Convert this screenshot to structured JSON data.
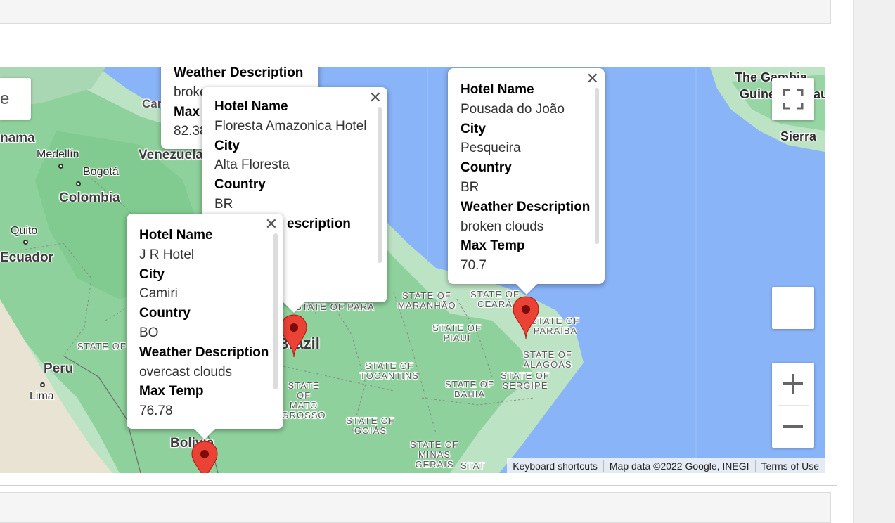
{
  "map": {
    "labels": {
      "the_gambia": "The Gambia",
      "guinea": "Guinea-Bissau",
      "sierra": "Sierra",
      "panama": "nama",
      "medellin": "Medellín",
      "bogota": "Bogotá",
      "colombia": "Colombia",
      "venezuela": "Venezuela",
      "caribbean": "Car",
      "quito": "Quito",
      "ecuador": "Ecuador",
      "peru": "Peru",
      "lima": "Lima",
      "brazil": "Brazil",
      "bolivia": "Bolivia",
      "state_para": "STATE OF PARÁ",
      "state_maranhao": "STATE OF MARANHÃO",
      "state_ceara": "STATE OF CEARÁ",
      "state_paraiba": "STATE OF PARAÍBA",
      "state_piaui": "STATE OF PIAUÍ",
      "state_alagoas": "STATE OF ALAGOAS",
      "state_sergipe": "STATE OF SERGIPE",
      "state_bahia": "STATE OF BAHIA",
      "state_tocantins": "STATE OF TOCANTINS",
      "state_mato_grosso": "STATE OF MATO GROSSO",
      "state_goias": "STATE OF GOIÁS",
      "state_minas": "STATE OF MINAS GERAIS",
      "state_west": "STATE OF",
      "state_es": "STAT"
    },
    "search_stub_text": "e",
    "footer": {
      "shortcuts": "Keyboard shortcuts",
      "map_data": "Map data ©2022 Google, INEGI",
      "terms": "Terms of Use"
    },
    "popups": {
      "partial_top": {
        "weather_label": "Weather Description",
        "weather_value": "broke",
        "max_label": "Max",
        "max_value": "82.38"
      },
      "alta_floresta": {
        "hotel_label": "Hotel Name",
        "hotel_value": "Floresta Amazonica Hotel",
        "city_label": "City",
        "city_value": "Alta Floresta",
        "country_label": "Country",
        "country_value": "BR",
        "weather_label_fragment": "escription"
      },
      "camiri": {
        "hotel_label": "Hotel Name",
        "hotel_value": "J R Hotel",
        "city_label": "City",
        "city_value": "Camiri",
        "country_label": "Country",
        "country_value": "BO",
        "weather_label": "Weather Description",
        "weather_value": "overcast clouds",
        "max_label": "Max Temp",
        "max_value": "76.78"
      },
      "pesqueira": {
        "hotel_label": "Hotel Name",
        "hotel_value": "Pousada do João",
        "city_label": "City",
        "city_value": "Pesqueira",
        "country_label": "Country",
        "country_value": "BR",
        "weather_label": "Weather Description",
        "weather_value": "broken clouds",
        "max_label": "Max Temp",
        "max_value": "70.7"
      }
    },
    "colors": {
      "ocean": "#8ab4f8",
      "land": "#bde3c5",
      "forest": "#8ed19c",
      "marker": "#ea4335"
    },
    "icons": {
      "fullscreen": "fullscreen-icon",
      "zoom_in": "plus-icon",
      "zoom_out": "minus-icon",
      "close": "close-icon",
      "marker": "map-pin-icon"
    }
  }
}
